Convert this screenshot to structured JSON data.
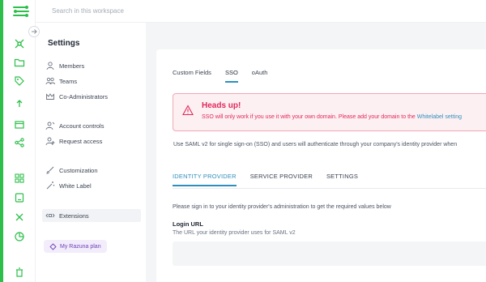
{
  "search": {
    "placeholder": "Search in this workspace"
  },
  "sidebar": {
    "title": "Settings",
    "items": [
      {
        "label": "Members",
        "icon": "user-icon"
      },
      {
        "label": "Teams",
        "icon": "users-icon"
      },
      {
        "label": "Co-Administrators",
        "icon": "crown-icon"
      },
      {
        "label": "Account controls",
        "icon": "account-controls-icon"
      },
      {
        "label": "Request access",
        "icon": "request-access-icon"
      },
      {
        "label": "Customization",
        "icon": "brush-icon"
      },
      {
        "label": "White Label",
        "icon": "magic-wand-icon"
      },
      {
        "label": "Extensions",
        "icon": "extensions-icon"
      }
    ],
    "plan_label": "My Razuna plan"
  },
  "tabs": [
    "Custom Fields",
    "SSO",
    "oAuth"
  ],
  "alert": {
    "title": "Heads up!",
    "message_before": "SSO will only work if you use it with your own domain. Please add your domain to the ",
    "message_link": "Whitelabel setting"
  },
  "description": "Use SAML v2 for single sign-on (SSO) and users will authenticate through your company's identity provider when",
  "subtabs": [
    "IDENTITY PROVIDER",
    "SERVICE PROVIDER",
    "SETTINGS"
  ],
  "hint": "Please sign in to your identity provider's administration to get the required values below",
  "login_url": {
    "label": "Login URL",
    "sub": "The URL your identity provider uses for SAML v2",
    "value": ""
  },
  "colors": {
    "accent": "#2f8fbc",
    "alert": "#e0285a",
    "brand": "#2dbf4a",
    "plan": "#6d3fb7"
  }
}
